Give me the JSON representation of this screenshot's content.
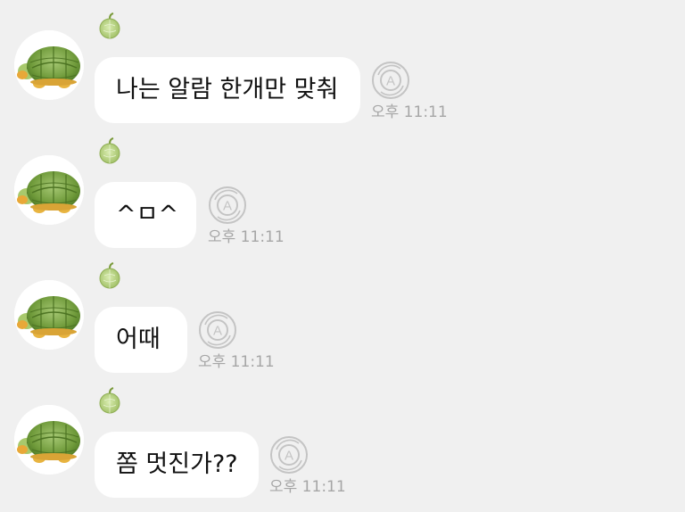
{
  "messages": [
    {
      "text": "나는 알람 한개만 맞춰",
      "time": "오후 11:11"
    },
    {
      "text": "^ㅁ^",
      "time": "오후 11:11"
    },
    {
      "text": "어때",
      "time": "오후 11:11"
    },
    {
      "text": "쫌 멋진가??",
      "time": "오후 11:11"
    }
  ],
  "icons": {
    "avatar": "turtle-plush-avatar",
    "badge": "melon-icon",
    "read_status": "auto-translate-a-icon"
  },
  "colors": {
    "background": "#f0f0f0",
    "bubble": "#ffffff",
    "time_text": "#a6a6a6",
    "turtle_shell": "#6f9a3a",
    "melon": "#b8d28a"
  }
}
